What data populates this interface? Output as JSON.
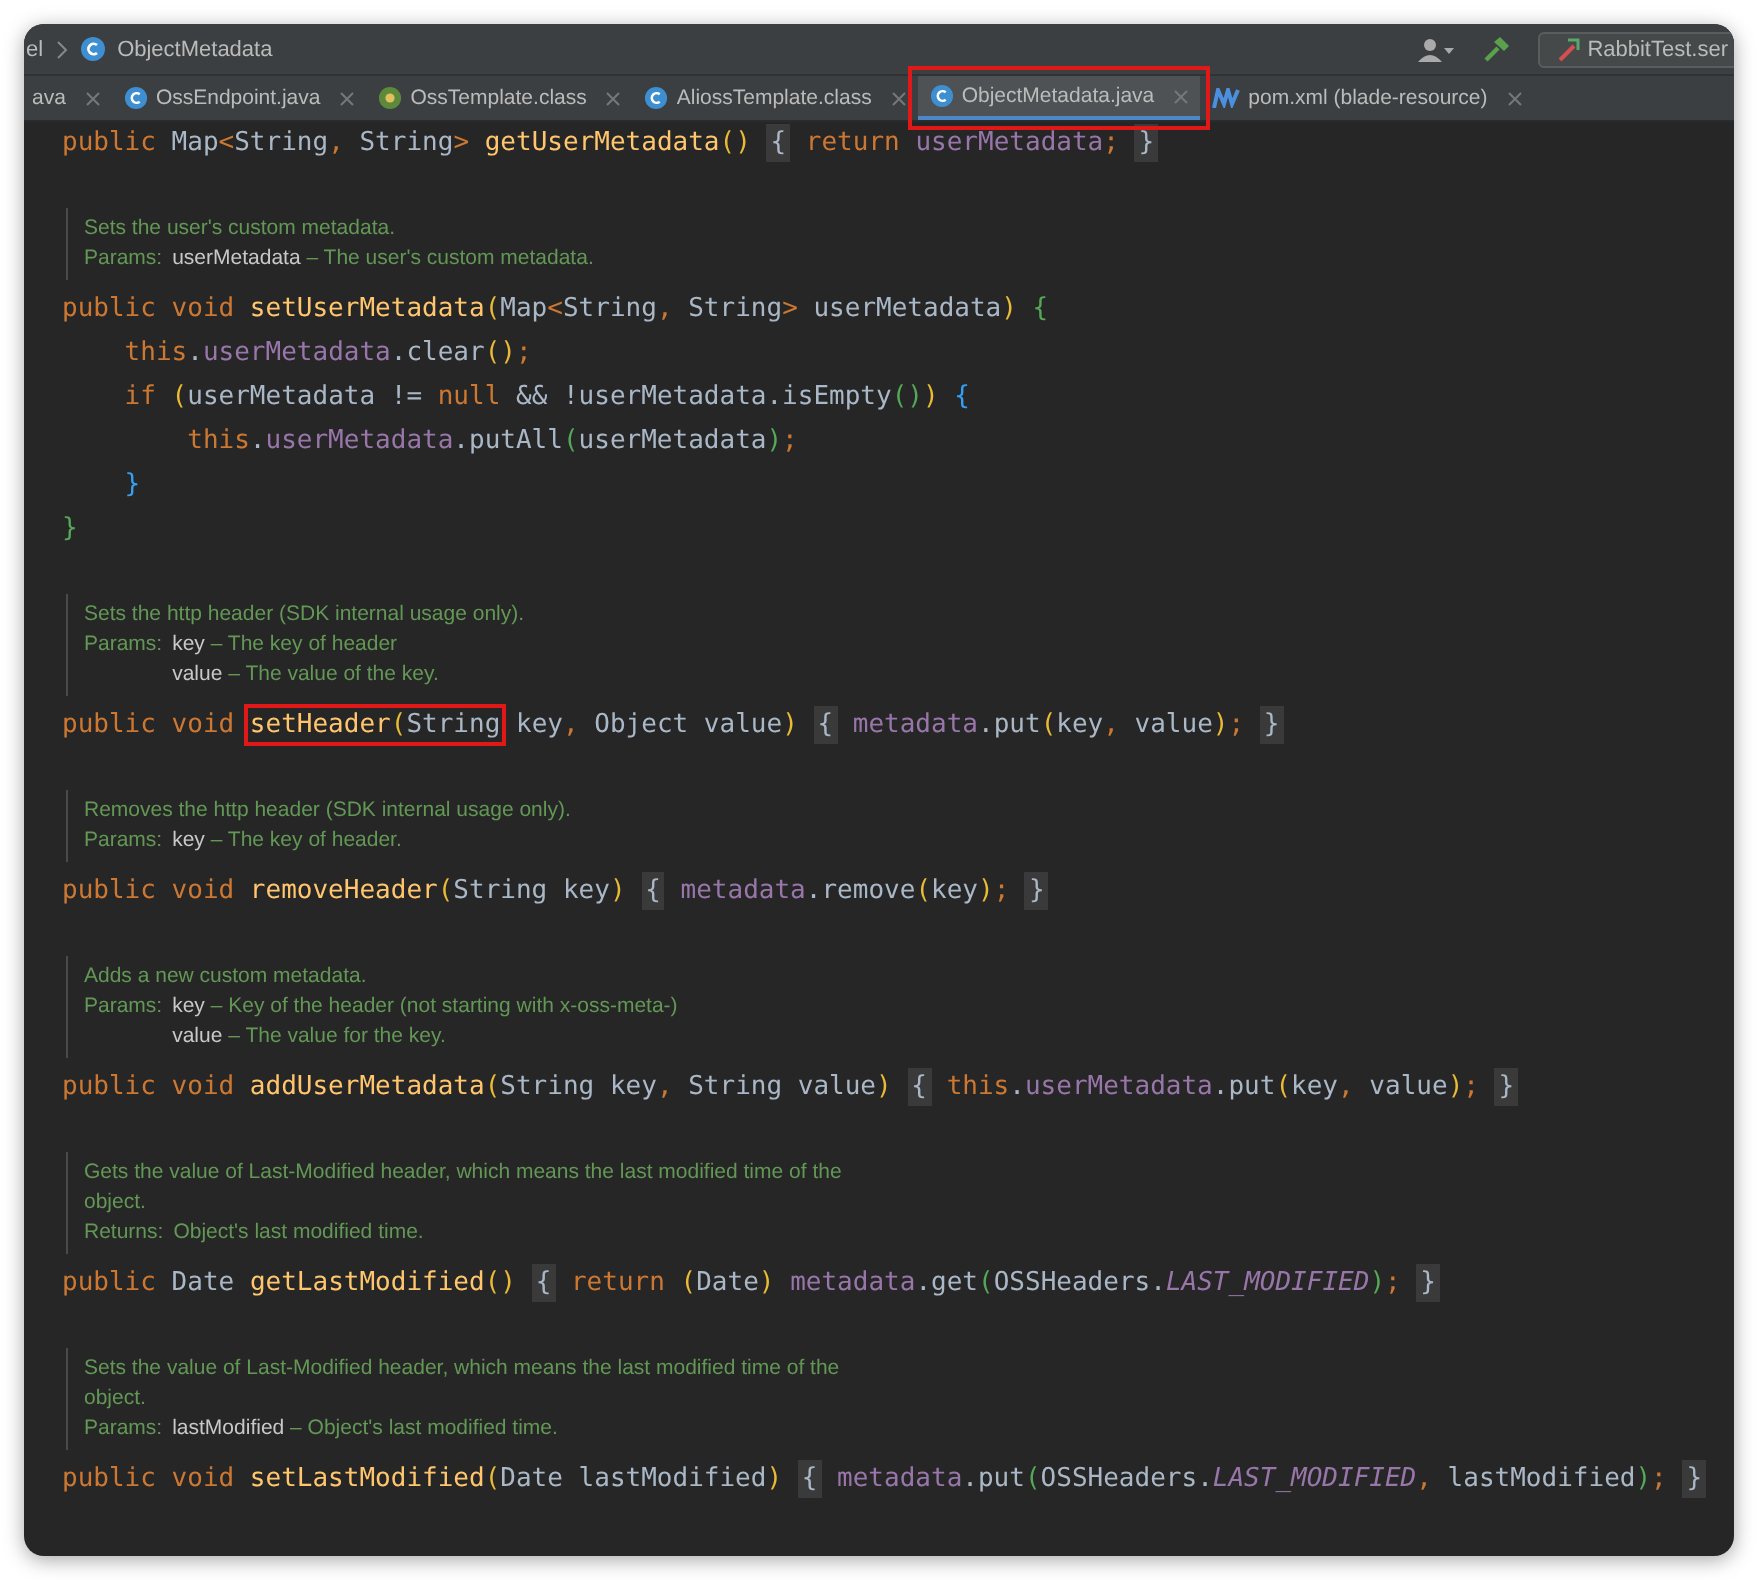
{
  "breadcrumb": {
    "items": [
      "el",
      "ObjectMetadata"
    ]
  },
  "toolbar": {
    "run_config": "RabbitTest.ser"
  },
  "tabs": [
    {
      "label": "ava",
      "kind": "plain",
      "selected": false,
      "annotated": false
    },
    {
      "label": "OssEndpoint.java",
      "kind": "class",
      "selected": false,
      "annotated": false
    },
    {
      "label": "OssTemplate.class",
      "kind": "compiled",
      "selected": false,
      "annotated": false
    },
    {
      "label": "AliossTemplate.class",
      "kind": "class",
      "selected": false,
      "annotated": false
    },
    {
      "label": "ObjectMetadata.java",
      "kind": "class",
      "selected": true,
      "annotated": true
    },
    {
      "label": "pom.xml (blade-resource)",
      "kind": "maven",
      "selected": false,
      "annotated": false
    }
  ],
  "editor": {
    "blocks": [
      {
        "kind": "code",
        "tokens": [
          {
            "text": "public ",
            "kind": "kw"
          },
          {
            "text": "Map",
            "kind": "id"
          },
          {
            "text": "<",
            "kind": "kw"
          },
          {
            "text": "String",
            "kind": "id"
          },
          {
            "text": ", ",
            "kind": "kw"
          },
          {
            "text": "String",
            "kind": "id"
          },
          {
            "text": "> ",
            "kind": "kw"
          },
          {
            "text": "getUserMetadata",
            "kind": "fn"
          },
          {
            "text": "() ",
            "kind": "y"
          },
          {
            "text": "{",
            "kind": "fold"
          },
          {
            "text": " return ",
            "kind": "kw"
          },
          {
            "text": "userMetadata",
            "kind": "field"
          },
          {
            "text": "; ",
            "kind": "kw"
          },
          {
            "text": "}",
            "kind": "fold"
          }
        ]
      },
      {
        "kind": "doc",
        "lines": [
          {
            "text": "Sets the user's custom metadata."
          },
          {
            "label": "Params:",
            "params": [
              {
                "name": "userMetadata",
                "text": " – The user's custom metadata."
              }
            ]
          }
        ]
      },
      {
        "kind": "code",
        "tokens": [
          {
            "text": "public void ",
            "kind": "kw"
          },
          {
            "text": "setUserMetadata",
            "kind": "fn"
          },
          {
            "text": "(",
            "kind": "y"
          },
          {
            "text": "Map",
            "kind": "id"
          },
          {
            "text": "<",
            "kind": "kw"
          },
          {
            "text": "String",
            "kind": "id"
          },
          {
            "text": ", ",
            "kind": "kw"
          },
          {
            "text": "String",
            "kind": "id"
          },
          {
            "text": "> ",
            "kind": "kw"
          },
          {
            "text": "userMetadata",
            "kind": "id"
          },
          {
            "text": ") ",
            "kind": "y"
          },
          {
            "text": "{",
            "kind": "g"
          }
        ]
      },
      {
        "kind": "code",
        "tokens": [
          {
            "text": "    this",
            "kind": "kw"
          },
          {
            "text": ".",
            "kind": "id"
          },
          {
            "text": "userMetadata",
            "kind": "field"
          },
          {
            "text": ".clear",
            "kind": "id"
          },
          {
            "text": "()",
            "kind": "y"
          },
          {
            "text": ";",
            "kind": "kw"
          }
        ]
      },
      {
        "kind": "code",
        "tokens": [
          {
            "text": "    if ",
            "kind": "kw"
          },
          {
            "text": "(",
            "kind": "y"
          },
          {
            "text": "userMetadata != ",
            "kind": "id"
          },
          {
            "text": "null",
            "kind": "kw"
          },
          {
            "text": " && !userMetadata.isEmpty",
            "kind": "id"
          },
          {
            "text": "()",
            "kind": "g"
          },
          {
            "text": ") ",
            "kind": "y"
          },
          {
            "text": "{",
            "kind": "b"
          }
        ]
      },
      {
        "kind": "code",
        "tokens": [
          {
            "text": "        this",
            "kind": "kw"
          },
          {
            "text": ".",
            "kind": "id"
          },
          {
            "text": "userMetadata",
            "kind": "field"
          },
          {
            "text": ".putAll",
            "kind": "id"
          },
          {
            "text": "(",
            "kind": "g"
          },
          {
            "text": "userMetadata",
            "kind": "id"
          },
          {
            "text": ")",
            "kind": "g"
          },
          {
            "text": ";",
            "kind": "kw"
          }
        ]
      },
      {
        "kind": "code",
        "tokens": [
          {
            "text": "    }",
            "kind": "b"
          }
        ]
      },
      {
        "kind": "code",
        "tokens": [
          {
            "text": "}",
            "kind": "g"
          }
        ]
      },
      {
        "kind": "doc",
        "lines": [
          {
            "text": "Sets the http header (SDK internal usage only)."
          },
          {
            "label": "Params:",
            "params": [
              {
                "name": "key",
                "text": " – The key of header"
              },
              {
                "name": "value",
                "text": " – The value of the key."
              }
            ]
          }
        ]
      },
      {
        "kind": "code",
        "tokens": [
          {
            "text": "public void ",
            "kind": "kw"
          },
          {
            "text": "setHeader",
            "kind": "fn",
            "boxed": true
          },
          {
            "text": "(",
            "kind": "y",
            "boxed": true
          },
          {
            "text": "String",
            "kind": "id",
            "boxed": true
          },
          {
            "text": " key",
            "kind": "id"
          },
          {
            "text": ", ",
            "kind": "kw"
          },
          {
            "text": "Object value",
            "kind": "id"
          },
          {
            "text": ") ",
            "kind": "y"
          },
          {
            "text": "{",
            "kind": "fold"
          },
          {
            "text": " metadata",
            "kind": "field"
          },
          {
            "text": ".put",
            "kind": "id"
          },
          {
            "text": "(",
            "kind": "y"
          },
          {
            "text": "key",
            "kind": "id"
          },
          {
            "text": ", ",
            "kind": "kw"
          },
          {
            "text": "value",
            "kind": "id"
          },
          {
            "text": ")",
            "kind": "y"
          },
          {
            "text": "; ",
            "kind": "kw"
          },
          {
            "text": "}",
            "kind": "fold"
          }
        ]
      },
      {
        "kind": "doc",
        "lines": [
          {
            "text": "Removes the http header (SDK internal usage only)."
          },
          {
            "label": "Params:",
            "params": [
              {
                "name": "key",
                "text": " – The key of header."
              }
            ]
          }
        ]
      },
      {
        "kind": "code",
        "tokens": [
          {
            "text": "public void ",
            "kind": "kw"
          },
          {
            "text": "removeHeader",
            "kind": "fn"
          },
          {
            "text": "(",
            "kind": "y"
          },
          {
            "text": "String key",
            "kind": "id"
          },
          {
            "text": ") ",
            "kind": "y"
          },
          {
            "text": "{",
            "kind": "fold"
          },
          {
            "text": " metadata",
            "kind": "field"
          },
          {
            "text": ".remove",
            "kind": "id"
          },
          {
            "text": "(",
            "kind": "y"
          },
          {
            "text": "key",
            "kind": "id"
          },
          {
            "text": ")",
            "kind": "y"
          },
          {
            "text": "; ",
            "kind": "kw"
          },
          {
            "text": "}",
            "kind": "fold"
          }
        ]
      },
      {
        "kind": "doc",
        "lines": [
          {
            "text": "Adds a new custom metadata."
          },
          {
            "label": "Params:",
            "params": [
              {
                "name": "key",
                "text": " – Key of the header (not starting with x-oss-meta-)"
              },
              {
                "name": "value",
                "text": " – The value for the key."
              }
            ]
          }
        ]
      },
      {
        "kind": "code",
        "tokens": [
          {
            "text": "public void ",
            "kind": "kw"
          },
          {
            "text": "addUserMetadata",
            "kind": "fn"
          },
          {
            "text": "(",
            "kind": "y"
          },
          {
            "text": "String key",
            "kind": "id"
          },
          {
            "text": ", ",
            "kind": "kw"
          },
          {
            "text": "String value",
            "kind": "id"
          },
          {
            "text": ") ",
            "kind": "y"
          },
          {
            "text": "{",
            "kind": "fold"
          },
          {
            "text": " this",
            "kind": "kw"
          },
          {
            "text": ".",
            "kind": "id"
          },
          {
            "text": "userMetadata",
            "kind": "field"
          },
          {
            "text": ".put",
            "kind": "id"
          },
          {
            "text": "(",
            "kind": "y"
          },
          {
            "text": "key",
            "kind": "id"
          },
          {
            "text": ", ",
            "kind": "kw"
          },
          {
            "text": "value",
            "kind": "id"
          },
          {
            "text": ")",
            "kind": "y"
          },
          {
            "text": "; ",
            "kind": "kw"
          },
          {
            "text": "}",
            "kind": "fold"
          }
        ]
      },
      {
        "kind": "doc",
        "lines": [
          {
            "text": "Gets the value of Last-Modified header, which means the last modified time of the object."
          },
          {
            "label": "Returns:",
            "text": "Object's last modified time."
          }
        ]
      },
      {
        "kind": "code",
        "tokens": [
          {
            "text": "public ",
            "kind": "kw"
          },
          {
            "text": "Date ",
            "kind": "id"
          },
          {
            "text": "getLastModified",
            "kind": "fn"
          },
          {
            "text": "() ",
            "kind": "y"
          },
          {
            "text": "{",
            "kind": "fold"
          },
          {
            "text": " return ",
            "kind": "kw"
          },
          {
            "text": "(",
            "kind": "y"
          },
          {
            "text": "Date",
            "kind": "id"
          },
          {
            "text": ") ",
            "kind": "y"
          },
          {
            "text": "metadata",
            "kind": "field"
          },
          {
            "text": ".get",
            "kind": "id"
          },
          {
            "text": "(",
            "kind": "g"
          },
          {
            "text": "OSSHeaders.",
            "kind": "id"
          },
          {
            "text": "LAST_MODIFIED",
            "kind": "cst"
          },
          {
            "text": ")",
            "kind": "g"
          },
          {
            "text": "; ",
            "kind": "kw"
          },
          {
            "text": "}",
            "kind": "fold"
          }
        ]
      },
      {
        "kind": "doc",
        "lines": [
          {
            "text": "Sets the value of Last-Modified header, which means the last modified time of the object."
          },
          {
            "label": "Params:",
            "params": [
              {
                "name": "lastModified",
                "text": "  – Object's last modified time."
              }
            ]
          }
        ]
      },
      {
        "kind": "code",
        "tokens": [
          {
            "text": "public void ",
            "kind": "kw"
          },
          {
            "text": "setLastModified",
            "kind": "fn"
          },
          {
            "text": "(",
            "kind": "y"
          },
          {
            "text": "Date lastModified",
            "kind": "id"
          },
          {
            "text": ") ",
            "kind": "y"
          },
          {
            "text": "{",
            "kind": "fold"
          },
          {
            "text": " metadata",
            "kind": "field"
          },
          {
            "text": ".put",
            "kind": "id"
          },
          {
            "text": "(",
            "kind": "g"
          },
          {
            "text": "OSSHeaders.",
            "kind": "id"
          },
          {
            "text": "LAST_MODIFIED",
            "kind": "cst"
          },
          {
            "text": ", ",
            "kind": "kw"
          },
          {
            "text": "lastModified",
            "kind": "id"
          },
          {
            "text": ")",
            "kind": "g"
          },
          {
            "text": "; ",
            "kind": "kw"
          },
          {
            "text": "}",
            "kind": "fold"
          }
        ]
      }
    ]
  }
}
